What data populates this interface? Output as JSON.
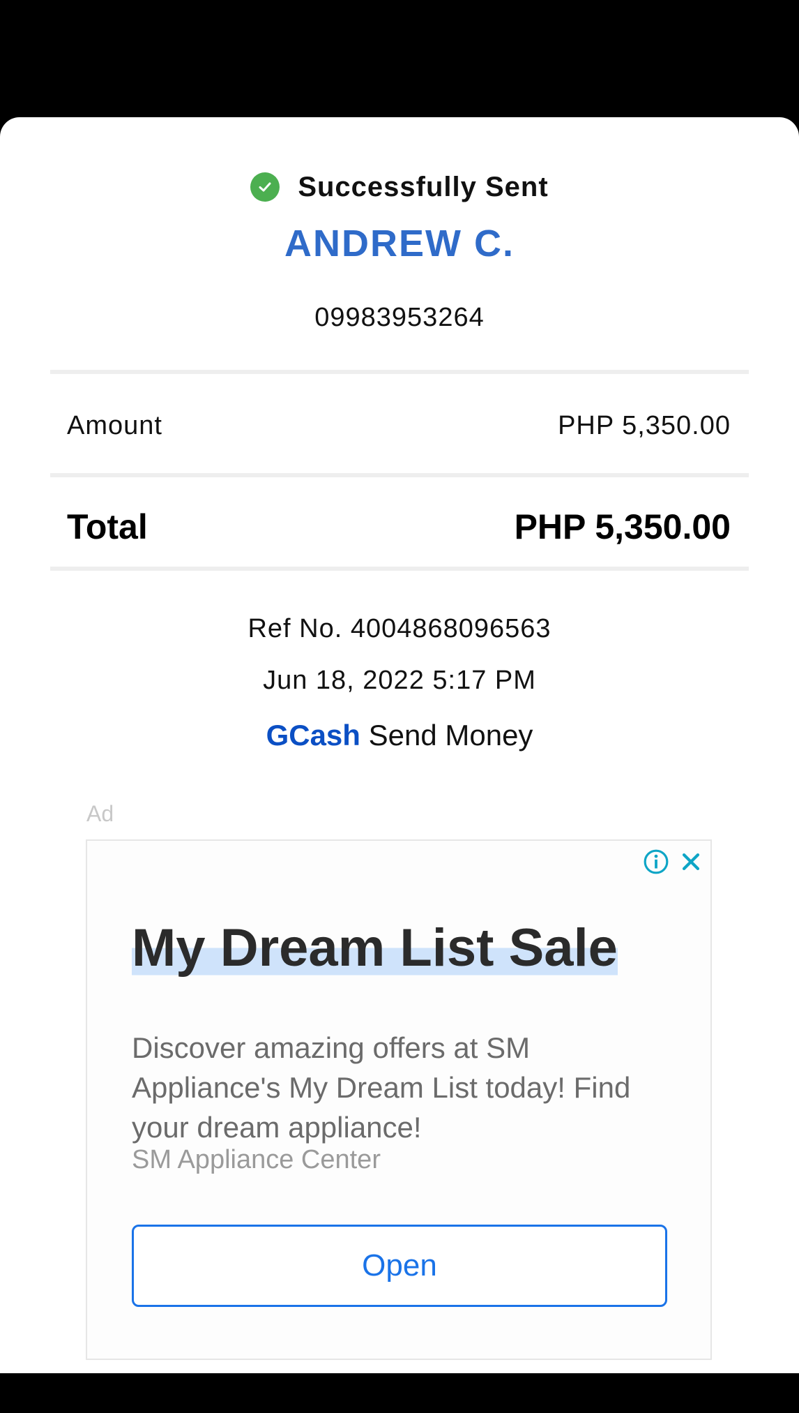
{
  "receipt": {
    "status": "Successfully Sent",
    "recipient_name": "ANDREW C.",
    "recipient_number": "09983953264",
    "amount_label": "Amount",
    "amount_value": "PHP 5,350.00",
    "total_label": "Total",
    "total_value": "PHP 5,350.00",
    "reference": "Ref No. 4004868096563",
    "datetime": "Jun 18, 2022 5:17 PM",
    "service_brand": "GCash",
    "service_name": "Send Money"
  },
  "ad": {
    "label": "Ad",
    "title": "My Dream List Sale",
    "description": "Discover amazing offers at SM Appliance's My Dream List today! Find your dream appliance!",
    "advertiser": "SM Appliance Center",
    "cta": "Open"
  },
  "colors": {
    "success": "#4caf50",
    "recipient": "#2f6bc9",
    "brand": "#0b4fc4",
    "ad_button": "#1a73e8",
    "ad_icon": "#0ea5c6"
  },
  "icons": {
    "status": "check-circle-icon",
    "ad_info": "info-icon",
    "ad_close": "close-icon"
  }
}
